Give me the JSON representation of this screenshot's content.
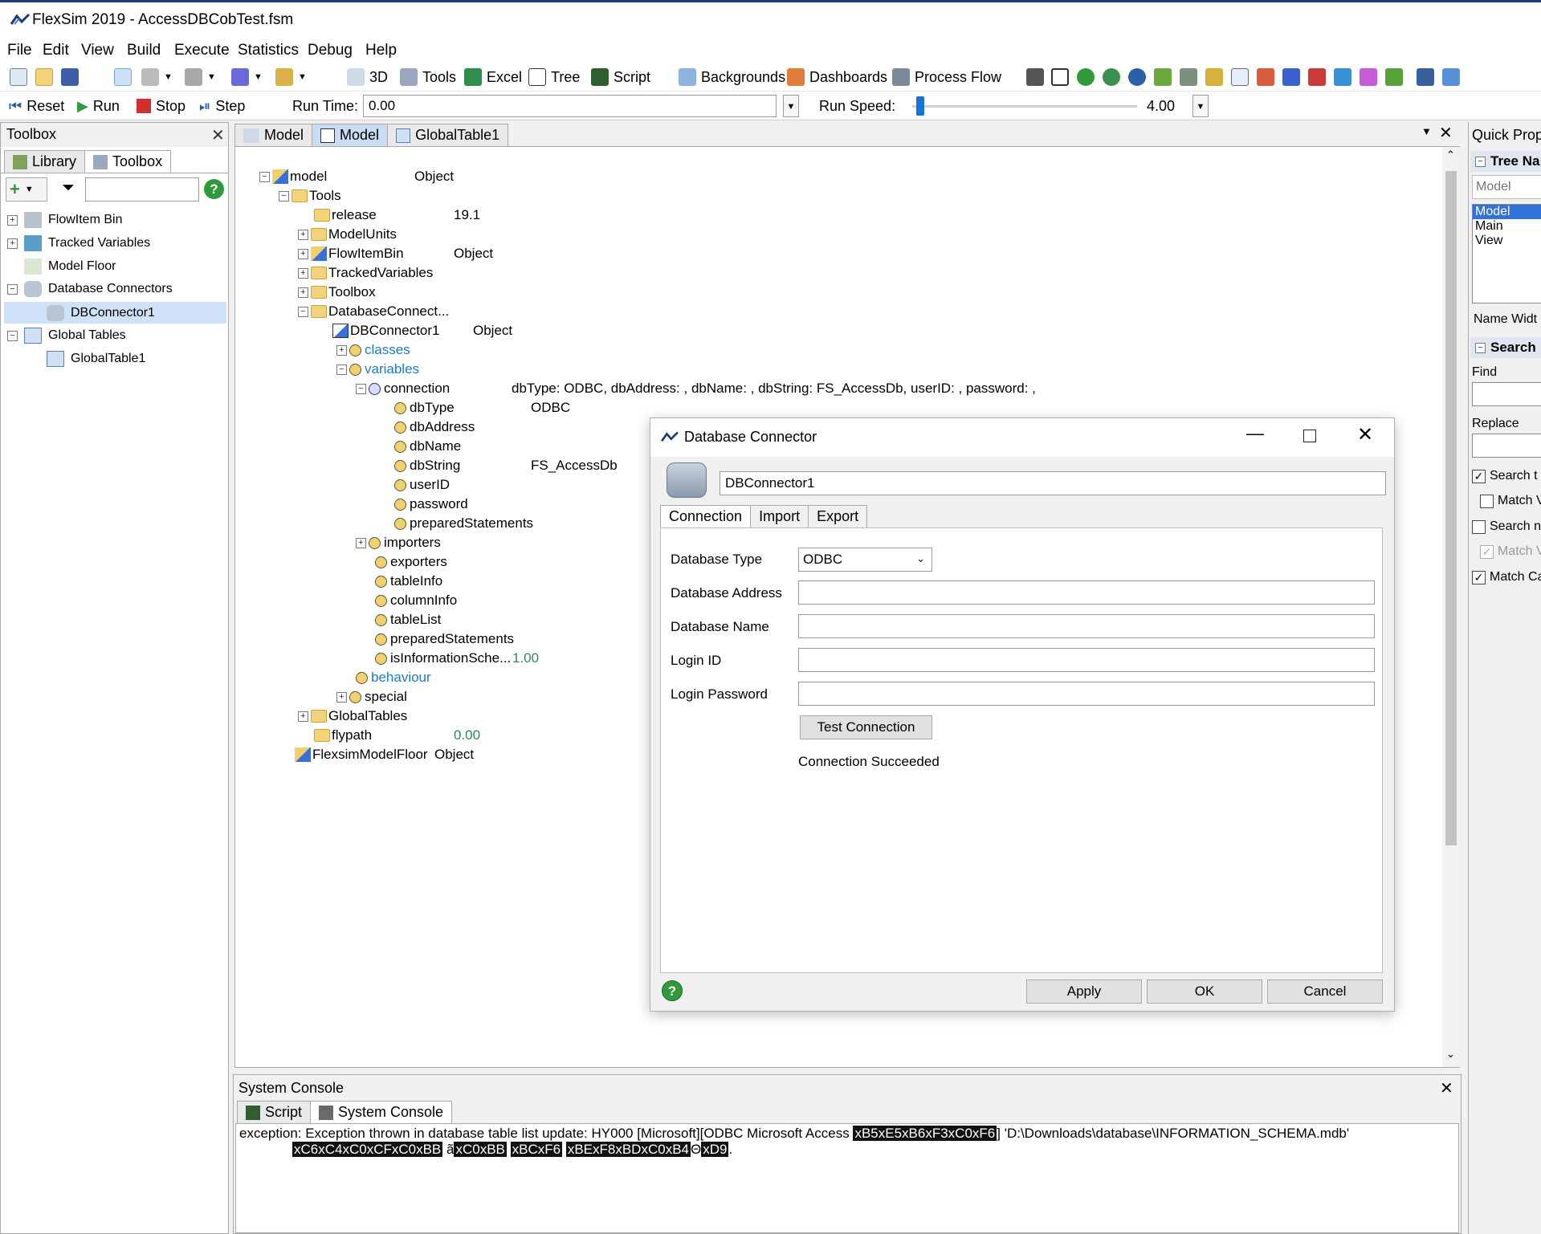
{
  "window": {
    "title": "FlexSim 2019 - AccessDBCobTest.fsm"
  },
  "menu": [
    "File",
    "Edit",
    "View",
    "Build",
    "Execute",
    "Statistics",
    "Debug",
    "Help"
  ],
  "toolbar": {
    "threed": "3D",
    "tools": "Tools",
    "excel": "Excel",
    "tree": "Tree",
    "script": "Script",
    "backgrounds": "Backgrounds",
    "dashboards": "Dashboards",
    "process_flow": "Process Flow"
  },
  "run_controls": {
    "reset": "Reset",
    "run": "Run",
    "stop": "Stop",
    "step": "Step",
    "run_time_label": "Run Time:",
    "run_time_value": "0.00",
    "run_speed_label": "Run Speed:",
    "run_speed_value": "4.00"
  },
  "toolbox": {
    "title": "Toolbox",
    "tabs": [
      "Library",
      "Toolbox"
    ],
    "items": [
      {
        "label": "FlowItem Bin"
      },
      {
        "label": "Tracked Variables"
      },
      {
        "label": "Model Floor"
      },
      {
        "label": "Database Connectors"
      },
      {
        "label": "DBConnector1"
      },
      {
        "label": "Global Tables"
      },
      {
        "label": "GlobalTable1"
      }
    ]
  },
  "doc_tabs": [
    "Model",
    "Model",
    "GlobalTable1"
  ],
  "tree": {
    "model": "model",
    "model_val": "Object",
    "tools": "Tools",
    "release": "release",
    "release_val": "19.1",
    "model_units": "ModelUnits",
    "flowitem_bin": "FlowItemBin",
    "flowitem_bin_val": "Object",
    "tracked_vars": "TrackedVariables",
    "toolbox": "Toolbox",
    "db_connectors": "DatabaseConnect...",
    "dbconnector1": "DBConnector1",
    "dbconnector1_val": "Object",
    "classes": "classes",
    "variables": "variables",
    "connection": "connection",
    "connection_val": "dbType: ODBC, dbAddress: , dbName: , dbString: FS_AccessDb, userID: , password: ,",
    "dbtype": "dbType",
    "dbtype_val": "ODBC",
    "dbaddress": "dbAddress",
    "dbname": "dbName",
    "dbstring": "dbString",
    "dbstring_val": "FS_AccessDb",
    "userid": "userID",
    "password": "password",
    "prepared1": "preparedStatements",
    "importers": "importers",
    "exporters": "exporters",
    "tableinfo": "tableInfo",
    "columninfo": "columnInfo",
    "tablelist": "tableList",
    "prepared2": "preparedStatements",
    "isinfo": "isInformationSche...",
    "isinfo_val": "1.00",
    "behaviour": "behaviour",
    "special": "special",
    "global_tables": "GlobalTables",
    "flypath": "flypath",
    "flypath_val": "0.00",
    "model_floor": "FlexsimModelFloor",
    "model_floor_val": "Object"
  },
  "dialog": {
    "title": "Database Connector",
    "name_value": "DBConnector1",
    "tabs": [
      "Connection",
      "Import",
      "Export"
    ],
    "database_type_label": "Database Type",
    "database_type_value": "ODBC",
    "database_address_label": "Database Address",
    "database_name_label": "Database Name",
    "login_id_label": "Login ID",
    "login_password_label": "Login Password",
    "test_connection": "Test Connection",
    "status": "Connection Succeeded",
    "apply": "Apply",
    "ok": "OK",
    "cancel": "Cancel"
  },
  "console": {
    "title": "System Console",
    "tabs": [
      "Script",
      "System Console"
    ],
    "line1_prefix": "exception: Exception thrown in database table list update: HY000 [Microsoft][ODBC Microsoft Access",
    "line1_hl": "xB5xE5xB6xF3xC0xF6",
    "line1_suffix": "] 'D:\\Downloads\\database\\INFORMATION_SCHEMA.mdb'",
    "line2_hl1": "xC6xC4xC0xCFxC0xBB",
    "line2_mid": "ã",
    "line2_hl2": "xC0xBB",
    "line2_hl3": "xBCxF6",
    "line2_hl4": "xBExF8xBDxC0xB4",
    "line2_theta": "Θ",
    "line2_hl5": "xD9",
    "line2_end": "."
  },
  "quick_properties": {
    "title": "Quick Prope",
    "tree_nav": "Tree Na",
    "path_value": "Model",
    "list": [
      "Model",
      "Main",
      "View"
    ],
    "name_width": "Name Widt",
    "search": "Search",
    "find": "Find",
    "replace": "Replace",
    "opt1": "Search t",
    "opt2": "Match V",
    "opt3": "Search n",
    "opt4": "Match V",
    "opt5": "Match Ca"
  }
}
